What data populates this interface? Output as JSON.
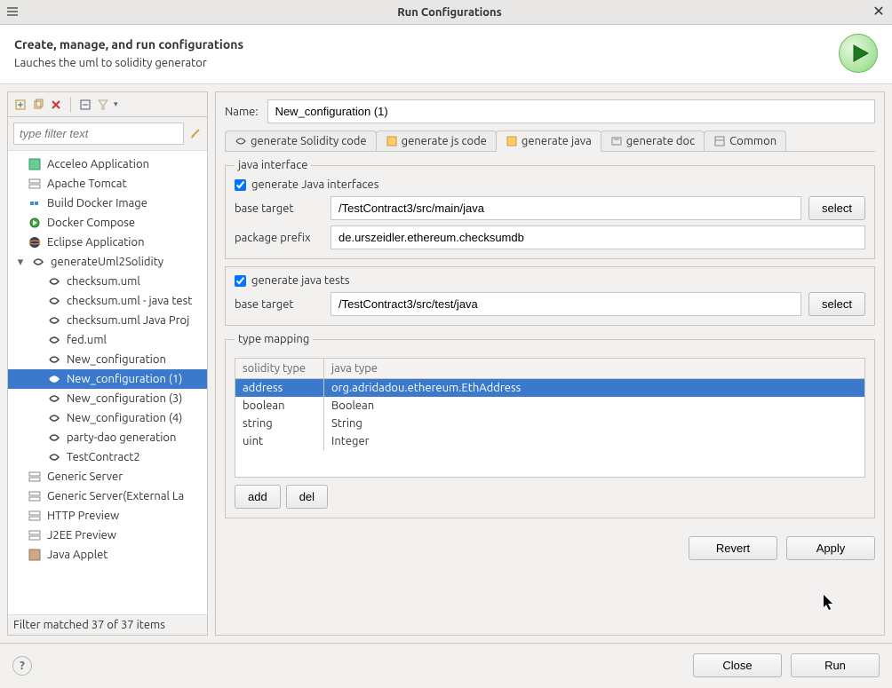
{
  "window": {
    "title": "Run Configurations"
  },
  "header": {
    "title": "Create, manage, and run configurations",
    "subtitle": "Lauches the uml to solidity generator"
  },
  "filter": {
    "placeholder": "type filter text",
    "status": "Filter matched 37 of 37 items"
  },
  "tree": {
    "items": [
      {
        "label": "Acceleo Application",
        "icon": "acceleo"
      },
      {
        "label": "Apache Tomcat",
        "icon": "server"
      },
      {
        "label": "Build Docker Image",
        "icon": "docker"
      },
      {
        "label": "Docker Compose",
        "icon": "compose"
      },
      {
        "label": "Eclipse Application",
        "icon": "eclipse"
      }
    ],
    "expanded": {
      "label": "generateUml2Solidity",
      "children": [
        "checksum.uml",
        "checksum.uml - java test",
        "checksum.uml Java Proj",
        "fed.uml",
        "New_configuration",
        "New_configuration (1)",
        "New_configuration (3)",
        "New_configuration (4)",
        "party-dao generation",
        "TestContract2"
      ],
      "selected_index": 5
    },
    "items_after": [
      {
        "label": "Generic Server",
        "icon": "server"
      },
      {
        "label": "Generic Server(External La",
        "icon": "server"
      },
      {
        "label": "HTTP Preview",
        "icon": "server"
      },
      {
        "label": "J2EE Preview",
        "icon": "server"
      },
      {
        "label": "Java Applet",
        "icon": "applet"
      }
    ]
  },
  "form": {
    "name_label": "Name:",
    "name_value": "New_configuration (1)",
    "tabs": [
      "generate Solidity code",
      "generate js code",
      "generate java",
      "generate doc",
      "Common"
    ],
    "active_tab": 2,
    "java_interface": {
      "legend": "java interface",
      "checkbox_label": "generate Java interfaces",
      "base_target_label": "base target",
      "base_target_value": "/TestContract3/src/main/java",
      "package_prefix_label": "package prefix",
      "package_prefix_value": "de.urszeidler.ethereum.checksumdb",
      "select_label": "select"
    },
    "java_tests": {
      "checkbox_label": "generate java tests",
      "base_target_label": "base target",
      "base_target_value": "/TestContract3/src/test/java",
      "select_label": "select"
    },
    "type_mapping": {
      "legend": "type mapping",
      "col1": "solidity type",
      "col2": "java type",
      "rows": [
        {
          "sol": "address",
          "java": "org.adridadou.ethereum.EthAddress",
          "selected": true
        },
        {
          "sol": "boolean",
          "java": "Boolean"
        },
        {
          "sol": "string",
          "java": "String"
        },
        {
          "sol": "uint",
          "java": "Integer"
        }
      ],
      "add_label": "add",
      "del_label": "del"
    },
    "revert": "Revert",
    "apply": "Apply"
  },
  "footer": {
    "close": "Close",
    "run": "Run"
  }
}
